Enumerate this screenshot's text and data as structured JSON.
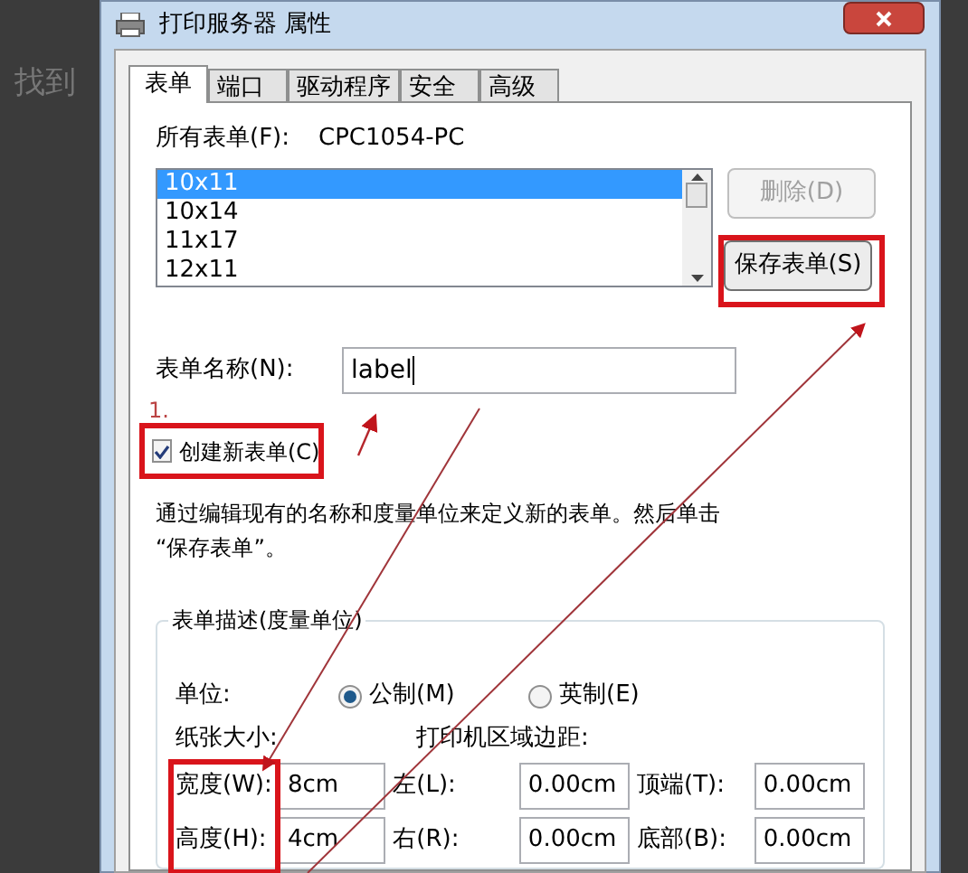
{
  "background_text": "找到",
  "window": {
    "title": "打印服务器 属性"
  },
  "tabs": [
    {
      "label": "表单",
      "selected": true
    },
    {
      "label": "端口",
      "selected": false
    },
    {
      "label": "驱动程序",
      "selected": false
    },
    {
      "label": "安全",
      "selected": false
    },
    {
      "label": "高级",
      "selected": false
    }
  ],
  "all_forms": {
    "label": "所有表单(F):",
    "server": "CPC1054-PC"
  },
  "forms_list": [
    {
      "label": "10x11",
      "selected": true
    },
    {
      "label": "10x14",
      "selected": false
    },
    {
      "label": "11x17",
      "selected": false
    },
    {
      "label": "12x11",
      "selected": false
    }
  ],
  "delete_button": {
    "label": "删除(D)",
    "disabled": true
  },
  "save_button": {
    "label": "保存表单(S)",
    "highlighted": true
  },
  "form_name": {
    "label": "表单名称(N):",
    "value": "label"
  },
  "step_label": "1.",
  "create_new": {
    "label": "创建新表单(C)",
    "checked": true,
    "highlighted": true
  },
  "description": "通过编辑现有的名称和度量单位来定义新的表单。然后单击 “保存表单”。",
  "measure_group": {
    "title": "表单描述(度量单位)",
    "unit_label": "单位:",
    "units": [
      {
        "label": "公制(M)",
        "selected": true
      },
      {
        "label": "英制(E)",
        "selected": false
      }
    ],
    "paper_size_label": "纸张大小:",
    "margins_label": "打印机区域边距:",
    "size_highlighted": true,
    "size_fields": [
      {
        "label": "宽度(W):",
        "value": "8cm"
      },
      {
        "label": "高度(H):",
        "value": "4cm"
      }
    ],
    "margin_fields": [
      {
        "label": "左(L):",
        "value": "0.00cm"
      },
      {
        "label": "顶端(T):",
        "value": "0.00cm"
      },
      {
        "label": "右(R):",
        "value": "0.00cm"
      },
      {
        "label": "底部(B):",
        "value": "0.00cm"
      }
    ]
  }
}
